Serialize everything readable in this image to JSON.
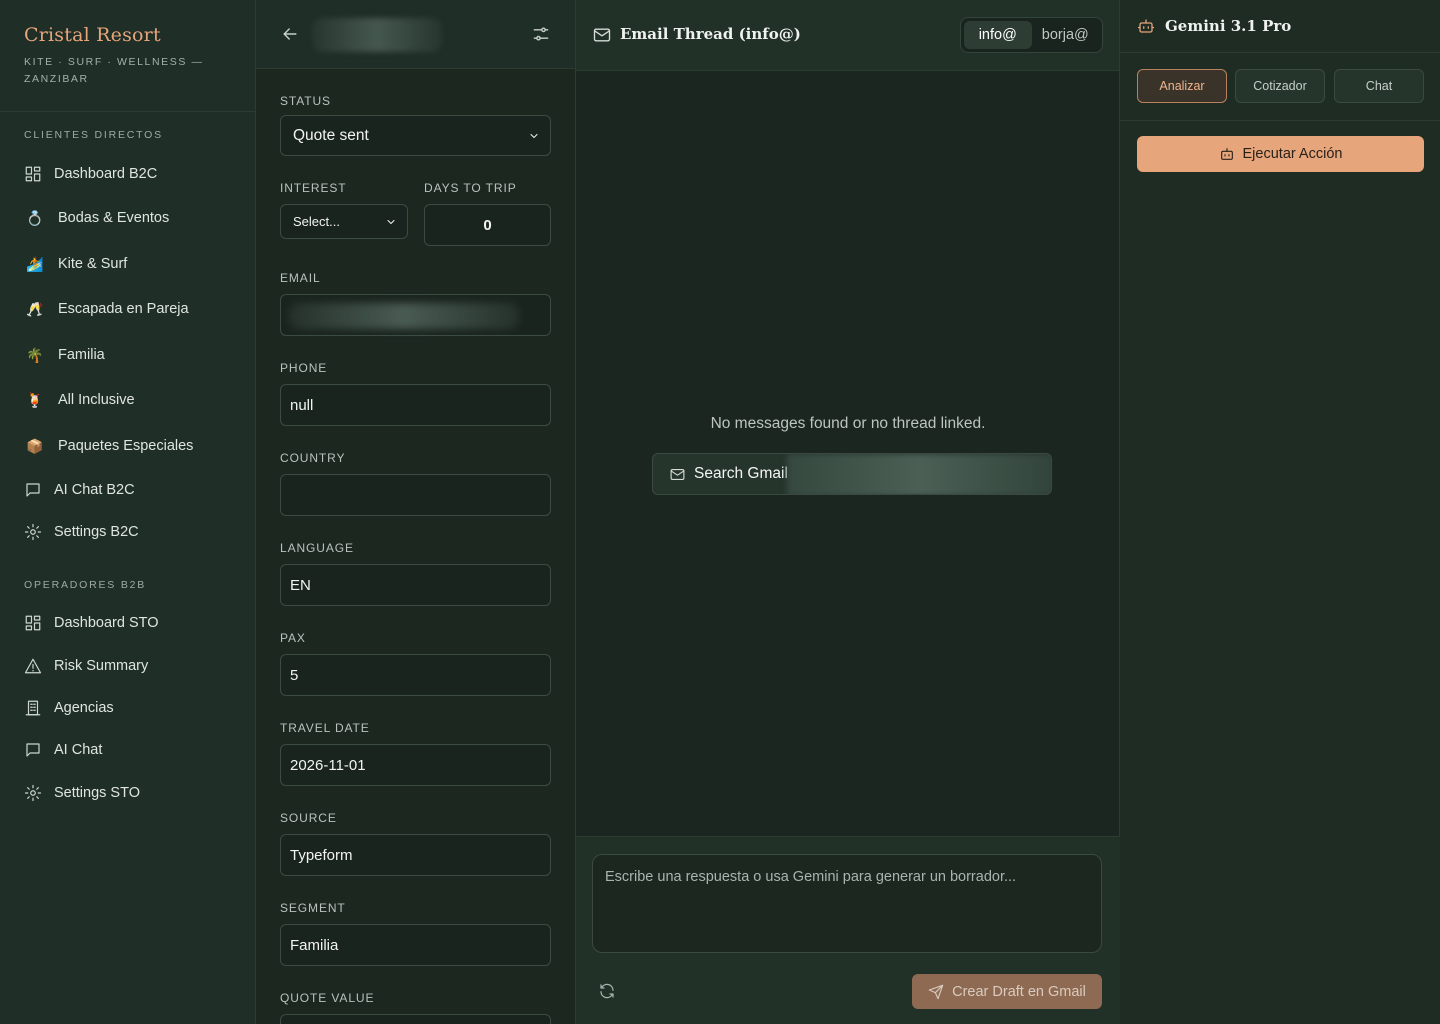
{
  "brand": {
    "title": "Cristal Resort",
    "subtitle": "KITE · SURF · WELLNESS — ZANZIBAR"
  },
  "sidebar": {
    "section_b2c": "CLIENTES DIRECTOS",
    "b2c_items": [
      {
        "label": "Dashboard B2C",
        "icon": "grid-icon"
      },
      {
        "label": "Bodas & Eventos",
        "icon": "ring-icon"
      },
      {
        "label": "Kite & Surf",
        "icon": "surfer-icon"
      },
      {
        "label": "Escapada en Pareja",
        "icon": "champagne-icon"
      },
      {
        "label": "Familia",
        "icon": "palm-icon"
      },
      {
        "label": "All Inclusive",
        "icon": "cocktail-icon"
      },
      {
        "label": "Paquetes Especiales",
        "icon": "package-icon"
      },
      {
        "label": "AI Chat B2C",
        "icon": "chat-icon"
      },
      {
        "label": "Settings B2C",
        "icon": "gear-icon"
      }
    ],
    "section_b2b": "OPERADORES B2B",
    "b2b_items": [
      {
        "label": "Dashboard STO",
        "icon": "grid-icon"
      },
      {
        "label": "Risk Summary",
        "icon": "warning-icon"
      },
      {
        "label": "Agencias",
        "icon": "building-icon"
      },
      {
        "label": "AI Chat",
        "icon": "chat-icon"
      },
      {
        "label": "Settings STO",
        "icon": "gear-icon"
      }
    ]
  },
  "details": {
    "status_label": "STATUS",
    "status_value": "Quote sent",
    "interest_label": "INTEREST",
    "interest_value": "Select...",
    "days_label": "DAYS TO TRIP",
    "days_value": "0",
    "email_label": "EMAIL",
    "phone_label": "PHONE",
    "phone_value": "null",
    "country_label": "COUNTRY",
    "country_value": "",
    "language_label": "LANGUAGE",
    "language_value": "EN",
    "pax_label": "PAX",
    "pax_value": "5",
    "travel_date_label": "TRAVEL DATE",
    "travel_date_value": "2026-11-01",
    "source_label": "SOURCE",
    "source_value": "Typeform",
    "segment_label": "SEGMENT",
    "segment_value": "Familia",
    "quote_label": "QUOTE VALUE"
  },
  "thread": {
    "title": "Email Thread (info@)",
    "accounts": [
      "info@",
      "borja@"
    ],
    "active_account": "info@",
    "empty_message": "No messages found or no thread linked.",
    "search_gmail": "Search Gmail",
    "reply_placeholder": "Escribe una respuesta o usa Gemini para generar un borrador...",
    "draft_button": "Crear Draft en Gmail"
  },
  "ai": {
    "title": "Gemini 3.1 Pro",
    "tabs": [
      "Analizar",
      "Cotizador",
      "Chat"
    ],
    "active_tab": "Analizar",
    "execute_button": "Ejecutar Acción"
  },
  "colors": {
    "accent": "#e7a57b",
    "sidebar_bg": "#1f2e26",
    "panel_bg": "#1b2620"
  }
}
